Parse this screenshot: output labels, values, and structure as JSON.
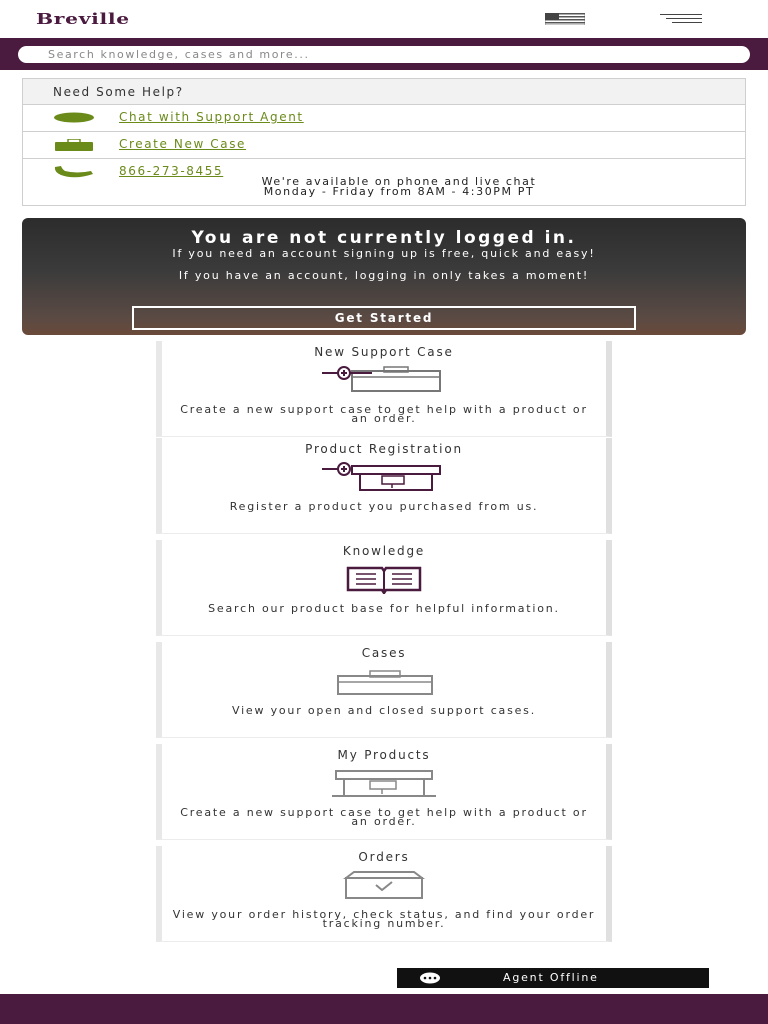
{
  "header": {
    "brand": "Breville",
    "flag_icon": "us-flag-icon",
    "menu_icon": "hamburger-menu-icon"
  },
  "search": {
    "placeholder": "Search knowledge, cases and more..."
  },
  "help": {
    "title": "Need Some Help?",
    "chat_label": "Chat with Support Agent",
    "case_label": "Create New Case",
    "phone": "866-273-8455",
    "availability_line1": "We're available on phone and live chat",
    "availability_line2": "Monday - Friday from 8AM - 4:30PM PT"
  },
  "banner": {
    "title": "You are not currently logged in.",
    "line1": "If you need an account signing up is free, quick and easy!",
    "line2": "If you have an account, logging in only takes a moment!",
    "button": "Get Started"
  },
  "tiles": [
    {
      "title": "New Support Case",
      "desc": "Create a new support case to get help with a product or an order.",
      "icon": "new-case-icon"
    },
    {
      "title": "Product Registration",
      "desc": "Register a product you purchased from us.",
      "icon": "product-registration-icon"
    },
    {
      "title": "Knowledge",
      "desc": "Search our product base for helpful information.",
      "icon": "book-icon"
    },
    {
      "title": "Cases",
      "desc": "View your open and closed support cases.",
      "icon": "cases-icon"
    },
    {
      "title": "My Products",
      "desc": "Create a new support case to get help with a product or an order.",
      "icon": "espresso-machine-icon"
    },
    {
      "title": "Orders",
      "desc": "View your order history, check status, and find your order tracking number.",
      "icon": "box-icon"
    }
  ],
  "agent": {
    "label": "Agent Offline"
  },
  "colors": {
    "brand": "#4a1a3f",
    "link": "#6a8a1a"
  }
}
